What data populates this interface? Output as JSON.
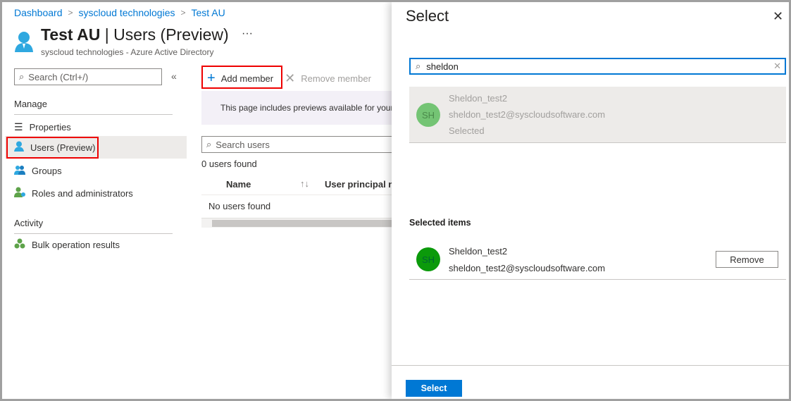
{
  "breadcrumb": [
    "Dashboard",
    "syscloud technologies",
    "Test AU"
  ],
  "header": {
    "title_bold": "Test AU",
    "title_rest": " | Users (Preview)",
    "subtitle": "syscloud technologies - Azure Active Directory",
    "more": "···"
  },
  "sidebar": {
    "search_placeholder": "Search (Ctrl+/)",
    "collapse": "«",
    "sections": [
      {
        "label": "Manage",
        "items": [
          {
            "label": "Properties",
            "icon": "properties-icon"
          },
          {
            "label": "Users (Preview)",
            "icon": "user-icon",
            "active": true
          },
          {
            "label": "Groups",
            "icon": "groups-icon"
          },
          {
            "label": "Roles and administrators",
            "icon": "roles-icon"
          }
        ]
      },
      {
        "label": "Activity",
        "items": [
          {
            "label": "Bulk operation results",
            "icon": "bulk-icon"
          }
        ]
      }
    ]
  },
  "toolbar": {
    "add_member": "Add member",
    "remove_member": "Remove member"
  },
  "main": {
    "banner": "This page includes previews available for your evaluation.",
    "search_placeholder": "Search users",
    "count": "0 users found",
    "columns": [
      "Name",
      "User principal n..."
    ],
    "empty": "No users found"
  },
  "panel": {
    "title": "Select",
    "search_value": "sheldon",
    "result": {
      "initials": "SH",
      "name": "Sheldon_test2",
      "email": "sheldon_test2@syscloudsoftware.com",
      "status": "Selected"
    },
    "selected_heading": "Selected items",
    "selected": {
      "initials": "SH",
      "name": "Sheldon_test2",
      "email": "sheldon_test2@syscloudsoftware.com",
      "remove": "Remove"
    },
    "select_button": "Select"
  },
  "colors": {
    "accent": "#0078d4",
    "highlight": "#e00000",
    "avatar_selected": "#0b9a0b",
    "avatar_dim": "#74c474"
  }
}
